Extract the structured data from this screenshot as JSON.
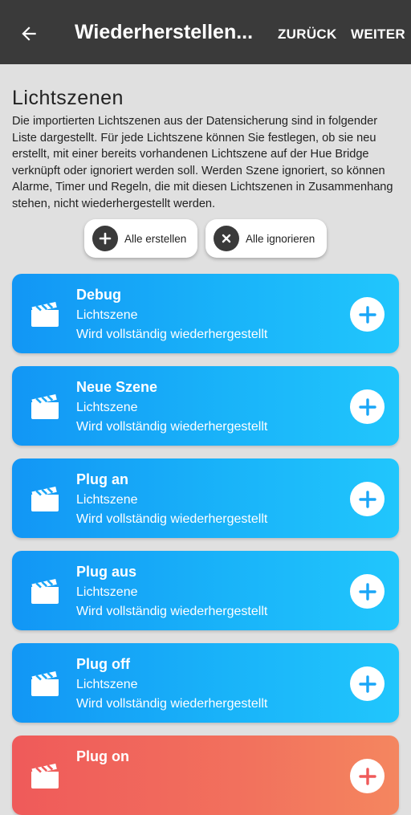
{
  "appbar": {
    "title": "Wiederherstellen...",
    "back_action": "ZURÜCK",
    "next_action": "WEITER"
  },
  "section": {
    "title": "Lichtszenen",
    "description": "Die importierten Lichtszenen aus der Datensicherung sind in folgender Liste dargestellt. Für jede Lichtszene können Sie festlegen, ob sie neu erstellt, mit einer bereits vorhandenen Lichtszene auf der Hue Bridge verknüpft oder ignoriert werden soll. Werden Szene ignoriert, so können Alarme, Timer und Regeln, die mit diesen Lichtszenen in Zusammenhang stehen, nicht wiederhergestellt werden."
  },
  "bulk": {
    "create_all": "Alle erstellen",
    "ignore_all": "Alle ignorieren"
  },
  "scenes": [
    {
      "name": "Debug",
      "type": "Lichtszene",
      "status": "Wird vollständig wiederhergestellt",
      "color": "#1296f5"
    },
    {
      "name": "Neue Szene",
      "type": "Lichtszene",
      "status": "Wird vollständig wiederhergestellt",
      "color": "#1296f5"
    },
    {
      "name": "Plug an",
      "type": "Lichtszene",
      "status": "Wird vollständig wiederhergestellt",
      "color": "#1296f5"
    },
    {
      "name": "Plug aus",
      "type": "Lichtszene",
      "status": "Wird vollständig wiederhergestellt",
      "color": "#1296f5"
    },
    {
      "name": "Plug off",
      "type": "Lichtszene",
      "status": "Wird vollständig wiederhergestellt",
      "color": "#1296f5"
    },
    {
      "name": "Plug on",
      "type": "",
      "status": "",
      "color": "#ef5a5a"
    }
  ],
  "icons": {
    "back": "arrow-left-icon",
    "create": "plus-icon",
    "ignore": "close-icon",
    "scene": "clapperboard-icon",
    "add": "plus-icon"
  }
}
